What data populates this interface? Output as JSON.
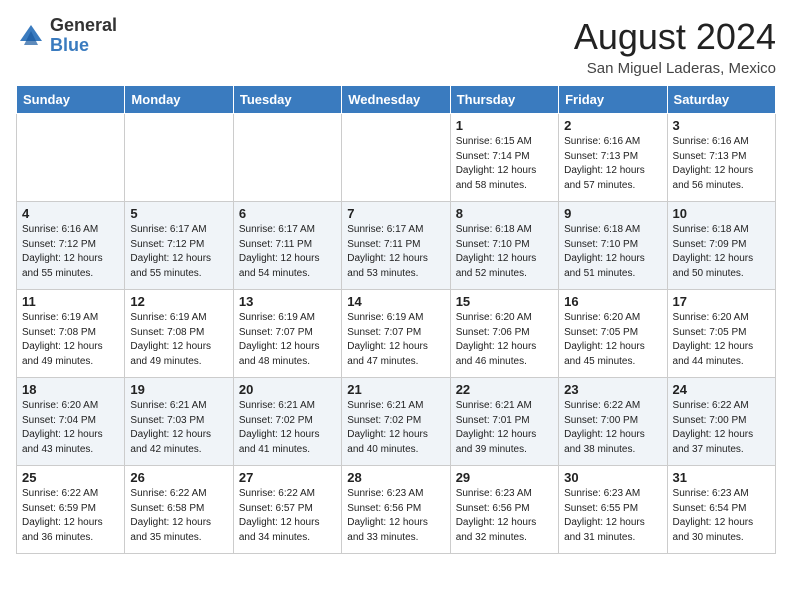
{
  "logo": {
    "general": "General",
    "blue": "Blue"
  },
  "header": {
    "month_year": "August 2024",
    "location": "San Miguel Laderas, Mexico"
  },
  "days_of_week": [
    "Sunday",
    "Monday",
    "Tuesday",
    "Wednesday",
    "Thursday",
    "Friday",
    "Saturday"
  ],
  "weeks": [
    [
      {
        "day": "",
        "info": ""
      },
      {
        "day": "",
        "info": ""
      },
      {
        "day": "",
        "info": ""
      },
      {
        "day": "",
        "info": ""
      },
      {
        "day": "1",
        "info": "Sunrise: 6:15 AM\nSunset: 7:14 PM\nDaylight: 12 hours\nand 58 minutes."
      },
      {
        "day": "2",
        "info": "Sunrise: 6:16 AM\nSunset: 7:13 PM\nDaylight: 12 hours\nand 57 minutes."
      },
      {
        "day": "3",
        "info": "Sunrise: 6:16 AM\nSunset: 7:13 PM\nDaylight: 12 hours\nand 56 minutes."
      }
    ],
    [
      {
        "day": "4",
        "info": "Sunrise: 6:16 AM\nSunset: 7:12 PM\nDaylight: 12 hours\nand 55 minutes."
      },
      {
        "day": "5",
        "info": "Sunrise: 6:17 AM\nSunset: 7:12 PM\nDaylight: 12 hours\nand 55 minutes."
      },
      {
        "day": "6",
        "info": "Sunrise: 6:17 AM\nSunset: 7:11 PM\nDaylight: 12 hours\nand 54 minutes."
      },
      {
        "day": "7",
        "info": "Sunrise: 6:17 AM\nSunset: 7:11 PM\nDaylight: 12 hours\nand 53 minutes."
      },
      {
        "day": "8",
        "info": "Sunrise: 6:18 AM\nSunset: 7:10 PM\nDaylight: 12 hours\nand 52 minutes."
      },
      {
        "day": "9",
        "info": "Sunrise: 6:18 AM\nSunset: 7:10 PM\nDaylight: 12 hours\nand 51 minutes."
      },
      {
        "day": "10",
        "info": "Sunrise: 6:18 AM\nSunset: 7:09 PM\nDaylight: 12 hours\nand 50 minutes."
      }
    ],
    [
      {
        "day": "11",
        "info": "Sunrise: 6:19 AM\nSunset: 7:08 PM\nDaylight: 12 hours\nand 49 minutes."
      },
      {
        "day": "12",
        "info": "Sunrise: 6:19 AM\nSunset: 7:08 PM\nDaylight: 12 hours\nand 49 minutes."
      },
      {
        "day": "13",
        "info": "Sunrise: 6:19 AM\nSunset: 7:07 PM\nDaylight: 12 hours\nand 48 minutes."
      },
      {
        "day": "14",
        "info": "Sunrise: 6:19 AM\nSunset: 7:07 PM\nDaylight: 12 hours\nand 47 minutes."
      },
      {
        "day": "15",
        "info": "Sunrise: 6:20 AM\nSunset: 7:06 PM\nDaylight: 12 hours\nand 46 minutes."
      },
      {
        "day": "16",
        "info": "Sunrise: 6:20 AM\nSunset: 7:05 PM\nDaylight: 12 hours\nand 45 minutes."
      },
      {
        "day": "17",
        "info": "Sunrise: 6:20 AM\nSunset: 7:05 PM\nDaylight: 12 hours\nand 44 minutes."
      }
    ],
    [
      {
        "day": "18",
        "info": "Sunrise: 6:20 AM\nSunset: 7:04 PM\nDaylight: 12 hours\nand 43 minutes."
      },
      {
        "day": "19",
        "info": "Sunrise: 6:21 AM\nSunset: 7:03 PM\nDaylight: 12 hours\nand 42 minutes."
      },
      {
        "day": "20",
        "info": "Sunrise: 6:21 AM\nSunset: 7:02 PM\nDaylight: 12 hours\nand 41 minutes."
      },
      {
        "day": "21",
        "info": "Sunrise: 6:21 AM\nSunset: 7:02 PM\nDaylight: 12 hours\nand 40 minutes."
      },
      {
        "day": "22",
        "info": "Sunrise: 6:21 AM\nSunset: 7:01 PM\nDaylight: 12 hours\nand 39 minutes."
      },
      {
        "day": "23",
        "info": "Sunrise: 6:22 AM\nSunset: 7:00 PM\nDaylight: 12 hours\nand 38 minutes."
      },
      {
        "day": "24",
        "info": "Sunrise: 6:22 AM\nSunset: 7:00 PM\nDaylight: 12 hours\nand 37 minutes."
      }
    ],
    [
      {
        "day": "25",
        "info": "Sunrise: 6:22 AM\nSunset: 6:59 PM\nDaylight: 12 hours\nand 36 minutes."
      },
      {
        "day": "26",
        "info": "Sunrise: 6:22 AM\nSunset: 6:58 PM\nDaylight: 12 hours\nand 35 minutes."
      },
      {
        "day": "27",
        "info": "Sunrise: 6:22 AM\nSunset: 6:57 PM\nDaylight: 12 hours\nand 34 minutes."
      },
      {
        "day": "28",
        "info": "Sunrise: 6:23 AM\nSunset: 6:56 PM\nDaylight: 12 hours\nand 33 minutes."
      },
      {
        "day": "29",
        "info": "Sunrise: 6:23 AM\nSunset: 6:56 PM\nDaylight: 12 hours\nand 32 minutes."
      },
      {
        "day": "30",
        "info": "Sunrise: 6:23 AM\nSunset: 6:55 PM\nDaylight: 12 hours\nand 31 minutes."
      },
      {
        "day": "31",
        "info": "Sunrise: 6:23 AM\nSunset: 6:54 PM\nDaylight: 12 hours\nand 30 minutes."
      }
    ]
  ]
}
